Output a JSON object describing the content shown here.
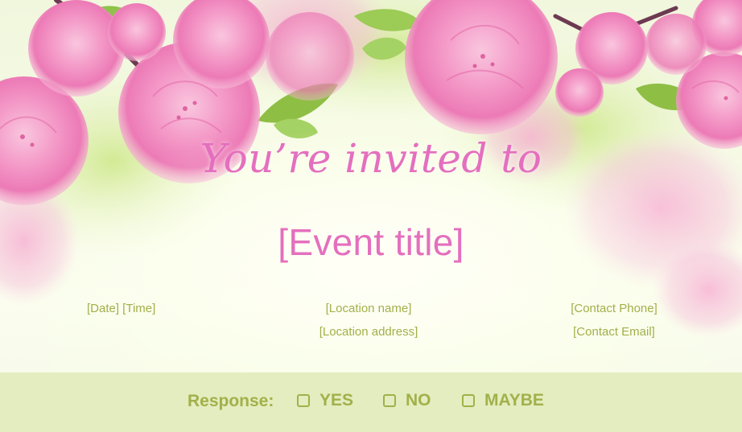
{
  "invitation": {
    "heading": "You’re invited to",
    "event_title": "[Event title]",
    "date_time": "[Date] [Time]",
    "location_name": "[Location name]",
    "location_address": "[Location address]",
    "contact_phone": "[Contact Phone]",
    "contact_email": "[Contact Email]"
  },
  "response": {
    "label": "Response:",
    "options": [
      "YES",
      "NO",
      "MAYBE"
    ]
  },
  "colors": {
    "accent_pink": "#e46fbe",
    "accent_green": "#a2b04a",
    "footer_bg": "#e3edbf"
  },
  "decoration": "pink-flower-blossoms"
}
